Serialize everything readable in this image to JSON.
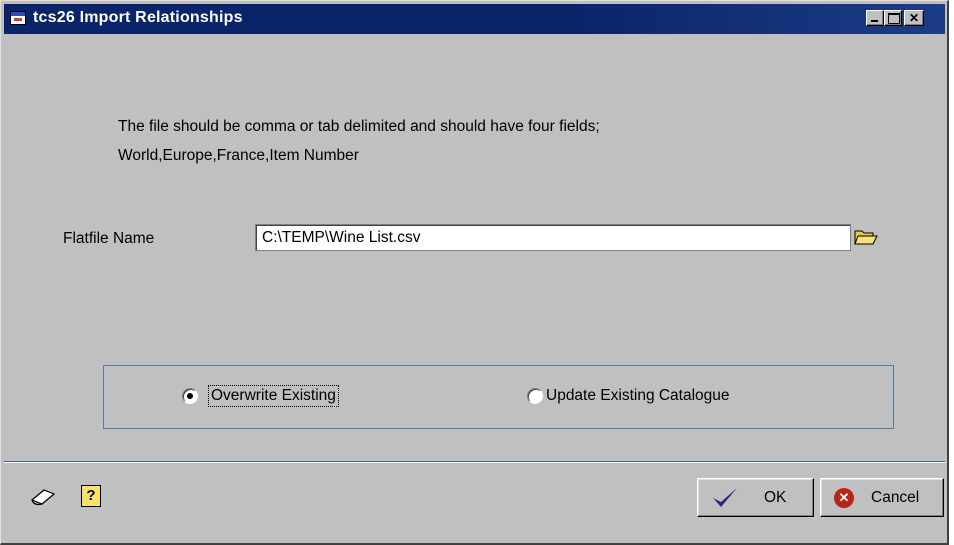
{
  "window": {
    "title": "tcs26 Import Relationships",
    "controls": {
      "minimize": "",
      "maximize": "",
      "close": "✕"
    }
  },
  "instructions": {
    "line1": "The file should be comma or tab delimited and should have  four fields;",
    "line2": "World,Europe,France,Item Number"
  },
  "flatfile": {
    "label": "Flatfile Name",
    "value": "C:\\TEMP\\Wine List.csv",
    "browse_icon": "folder-icon"
  },
  "options": {
    "items": [
      {
        "label": "Overwrite Existing",
        "checked": true
      },
      {
        "label": "Update Existing Catalogue",
        "checked": false
      }
    ]
  },
  "footer": {
    "icons": [
      "note-icon",
      "help-icon"
    ],
    "help_glyph": "?",
    "ok_label": "OK",
    "cancel_label": "Cancel",
    "cancel_glyph": "✕"
  },
  "colors": {
    "titlebar": "#0a246a",
    "dialog": "#c0c0c0",
    "group_border": "#5a7aa8",
    "ok_check": "#2a2a7a",
    "cancel_icon": "#b82418"
  }
}
